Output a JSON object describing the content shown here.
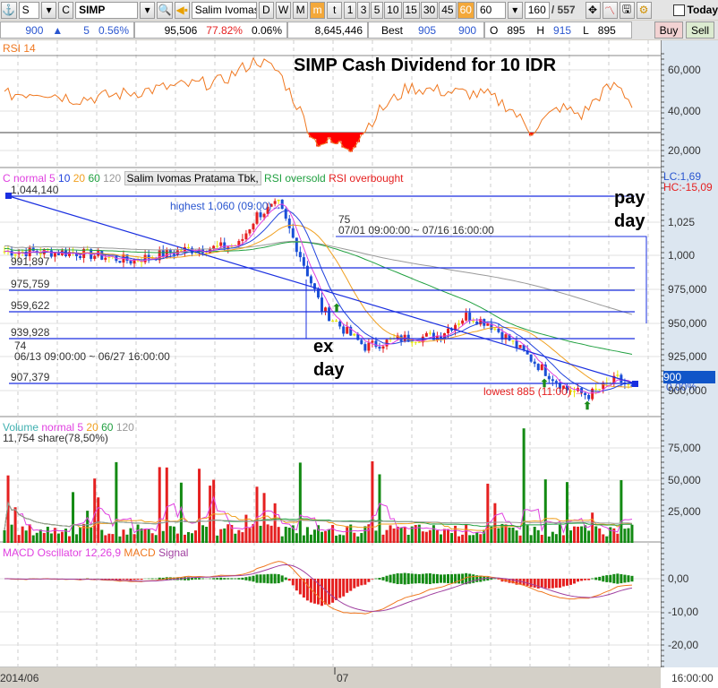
{
  "toolbar": {
    "market": "S",
    "type": "C",
    "symbol": "SIMP",
    "company": "Salim Ivomas Pr",
    "periods": [
      "D",
      "W",
      "M",
      "m",
      "t"
    ],
    "active_period": "m",
    "minutes": [
      "1",
      "3",
      "5",
      "10",
      "15",
      "30",
      "45",
      "60"
    ],
    "active_minute": "60",
    "minute_select": "60",
    "count": "160",
    "total": "/ 557",
    "today_label": "Today"
  },
  "quote": {
    "price": "900",
    "arrow": "▲",
    "change": "5",
    "change_pct": "0.56%",
    "volume": "95,506",
    "vol_pct": "77.82%",
    "turnover_pct": "0.06%",
    "value": "8,645,446",
    "best_label": "Best",
    "best_ask": "905",
    "best_bid": "900",
    "open_label": "O",
    "open": "895",
    "high_label": "H",
    "high": "915",
    "low_label": "L",
    "low": "895",
    "buy": "Buy",
    "sell": "Sell"
  },
  "rsi_panel": {
    "label": "RSI 14",
    "title": "SIMP Cash Dividend for 10 IDR",
    "ticks": [
      "60,000",
      "40,000",
      "20,000"
    ]
  },
  "price_panel": {
    "legend": {
      "c": "C normal 5",
      "m10": "10",
      "m20": "20",
      "m60": "60",
      "m120": "120",
      "name": "Salim Ivomas Pratama Tbk,",
      "oversold": "RSI oversold",
      "overbought": "RSI overbought"
    },
    "lc": "LC:1,69",
    "hc": "HC:-15,09",
    "ticks": [
      "1,025",
      "1,000",
      "975,000",
      "950,000",
      "925,000",
      "900,000"
    ],
    "current": "900",
    "current_pct": "0,00%",
    "levels": [
      "1,044,140",
      "991,897",
      "975,759",
      "959,622",
      "939,928",
      "907,379"
    ],
    "highest": "highest 1,060 (09:00)",
    "lowest": "lowest 885 (11:00)",
    "range1_count": "74",
    "range1": "06/13 09:00:00 ~ 06/27 16:00:00",
    "range2_count": "75",
    "range2": "07/01 09:00:00 ~ 07/16 16:00:00",
    "pay_day": "pay\nday",
    "pay1": "pay",
    "pay2": "day",
    "ex1": "ex",
    "ex2": "day"
  },
  "volume_panel": {
    "legend": {
      "v": "Volume",
      "n": "normal 5",
      "m20": "20",
      "m60": "60",
      "m120": "120"
    },
    "info": "11,754 share(78,50%)",
    "ticks": [
      "75,000",
      "50,000",
      "25,000"
    ]
  },
  "macd_panel": {
    "legend": {
      "osc": "MACD Oscillator 12,26,9",
      "macd": "MACD",
      "signal": "Signal"
    },
    "ticks": [
      "0,00",
      "-10,00",
      "-20,00"
    ]
  },
  "xaxis": {
    "labels": [
      "2014/06",
      "07"
    ],
    "time": "16:00:00"
  },
  "chart_data": {
    "type": "candlestick",
    "price_keypoints": [
      [
        0,
        1003
      ],
      [
        20,
        1002
      ],
      [
        35,
        996
      ],
      [
        50,
        1004
      ],
      [
        60,
        1006
      ],
      [
        65,
        1008
      ],
      [
        70,
        1030
      ],
      [
        76,
        1038
      ],
      [
        82,
        1000
      ],
      [
        88,
        960
      ],
      [
        94,
        945
      ],
      [
        100,
        932
      ],
      [
        110,
        938
      ],
      [
        120,
        940
      ],
      [
        128,
        955
      ],
      [
        134,
        950
      ],
      [
        140,
        937
      ],
      [
        148,
        918
      ],
      [
        156,
        900
      ],
      [
        162,
        896
      ],
      [
        170,
        908
      ],
      [
        174,
        900
      ]
    ],
    "rsi_keypoints": [
      [
        0,
        48
      ],
      [
        10,
        50
      ],
      [
        20,
        46
      ],
      [
        30,
        48
      ],
      [
        45,
        52
      ],
      [
        60,
        55
      ],
      [
        70,
        66
      ],
      [
        76,
        60
      ],
      [
        82,
        40
      ],
      [
        86,
        25
      ],
      [
        96,
        22
      ],
      [
        104,
        40
      ],
      [
        112,
        52
      ],
      [
        122,
        50
      ],
      [
        134,
        48
      ],
      [
        140,
        42
      ],
      [
        146,
        30
      ],
      [
        154,
        42
      ],
      [
        160,
        38
      ],
      [
        166,
        50
      ],
      [
        170,
        53
      ],
      [
        174,
        44
      ]
    ],
    "colors": {
      "up": "#e52020",
      "down": "#1a4fd6",
      "ma5": "#e040e0",
      "ma10": "#2244dd",
      "ma20": "#f0a020",
      "ma60": "#20a040",
      "ma120": "#999999",
      "rsi": "#f07820"
    }
  }
}
